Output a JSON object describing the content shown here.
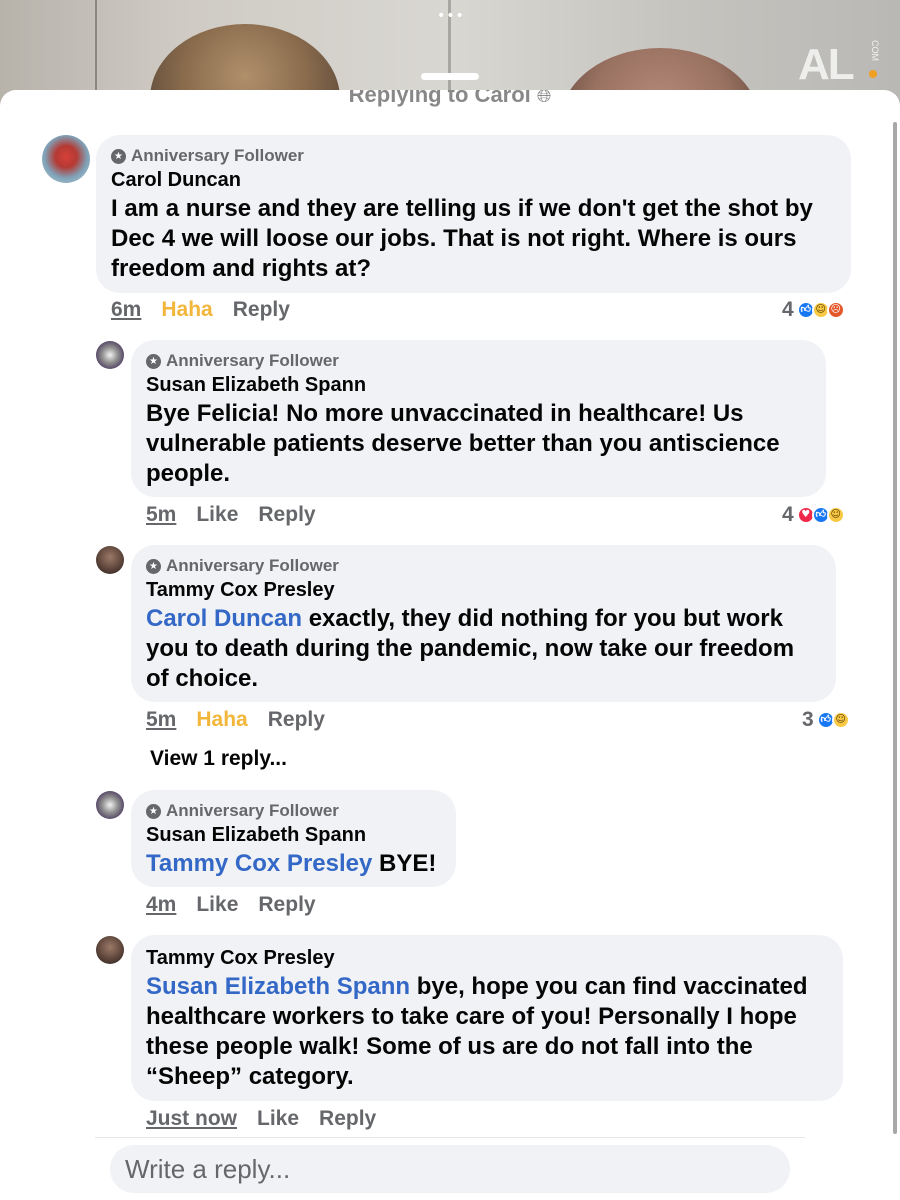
{
  "video": {
    "menu_dots": "•••",
    "logo_text": "AL",
    "logo_suffix": "COM"
  },
  "sheet": {
    "title": "Replying to Carol",
    "title_icon": "globe-icon"
  },
  "comments": [
    {
      "badge": "Anniversary Follower",
      "author": "Carol Duncan",
      "mention": "",
      "text": "I am a nurse and they are telling us if we don't get the shot by Dec 4 we will loose our jobs. That is not right. Where is ours freedom and rights at?",
      "time": "6m",
      "action1": "Haha",
      "reply": "Reply",
      "reaction_count": "4",
      "reactions": [
        "like",
        "haha",
        "angry"
      ]
    },
    {
      "badge": "Anniversary Follower",
      "author": "Susan Elizabeth Spann",
      "mention": "",
      "text": "Bye Felicia! No more unvaccinated in healthcare! Us vulnerable patients deserve better than you antiscience people.",
      "time": "5m",
      "action1": "Like",
      "reply": "Reply",
      "reaction_count": "4",
      "reactions": [
        "love",
        "like",
        "haha"
      ]
    },
    {
      "badge": "Anniversary Follower",
      "author": "Tammy Cox Presley",
      "mention": "Carol Duncan",
      "text": " exactly, they did nothing for you but work you to death during the pandemic, now take our freedom of choice.",
      "time": "5m",
      "action1": "Haha",
      "reply": "Reply",
      "reaction_count": "3",
      "reactions": [
        "like",
        "haha"
      ]
    },
    {
      "badge": "Anniversary Follower",
      "author": "Susan Elizabeth Spann",
      "mention": "Tammy Cox Presley",
      "text": " BYE!",
      "time": "4m",
      "action1": "Like",
      "reply": "Reply"
    },
    {
      "badge": "",
      "author": "Tammy Cox Presley",
      "mention": "Susan Elizabeth Spann",
      "text": " bye, hope you can find vaccinated healthcare workers to take care of you! Personally I hope these people walk! Some of us are do not fall into the “Sheep” category.",
      "time": "Just now",
      "action1": "Like",
      "reply": "Reply"
    }
  ],
  "view_replies": "View 1 reply...",
  "composer": {
    "placeholder": "Write a reply..."
  },
  "colors": {
    "mention": "#3468c7",
    "haha": "#f2b63a",
    "bubble": "#f0f2f5",
    "secondary_text": "#65676b"
  }
}
